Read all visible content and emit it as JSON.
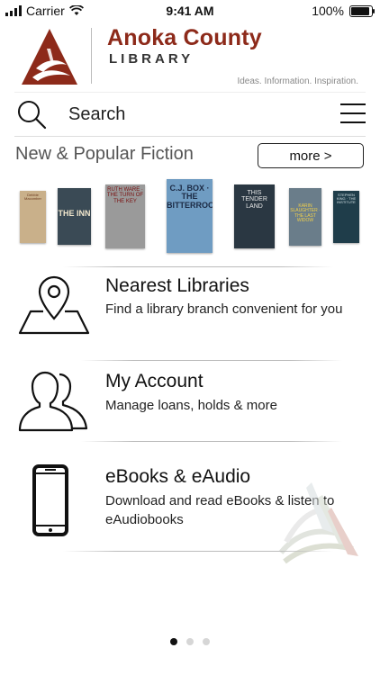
{
  "status_bar": {
    "carrier": "Carrier",
    "time": "9:41 AM",
    "battery": "100%",
    "battery_level": 1.0
  },
  "header": {
    "org_name": "Anoka County",
    "org_sub": "LIBRARY",
    "tagline": "Ideas. Information. Inspiration.",
    "brand_color": "#8d2a1a"
  },
  "search": {
    "placeholder": "Search"
  },
  "fiction": {
    "title": "New & Popular Fiction",
    "more_label": "more >",
    "books": [
      {
        "title": "Debbie Macomber",
        "bg": "#c9b08a",
        "fg": "#6b3a1f"
      },
      {
        "title": "THE INN",
        "bg": "#3a4a55",
        "fg": "#f0e6cc"
      },
      {
        "title": "RUTH WARE · THE TURN OF THE KEY",
        "bg": "#9a9a9a",
        "fg": "#7a1010"
      },
      {
        "title": "C.J. BOX · THE BITTERROOTS",
        "bg": "#6f9cc2",
        "fg": "#1b2a44"
      },
      {
        "title": "THIS TENDER LAND",
        "bg": "#2a3742",
        "fg": "#e8e8e8"
      },
      {
        "title": "KARIN SLAUGHTER · THE LAST WIDOW",
        "bg": "#6a7d8a",
        "fg": "#f2d04a"
      },
      {
        "title": "STEPHEN KING · THE INSTITUTE",
        "bg": "#1f3d4a",
        "fg": "#d7e4e8"
      }
    ]
  },
  "menu": [
    {
      "id": "nearest",
      "title": "Nearest Libraries",
      "desc": "Find a library branch convenient for you",
      "icon": "map-pin-icon"
    },
    {
      "id": "account",
      "title": "My Account",
      "desc": "Manage loans, holds & more",
      "icon": "users-icon"
    },
    {
      "id": "ebooks",
      "title": "eBooks & eAudio",
      "desc": "Download and read eBooks & listen to eAudiobooks",
      "icon": "phone-icon"
    }
  ],
  "pagination": {
    "count": 3,
    "active": 1
  }
}
